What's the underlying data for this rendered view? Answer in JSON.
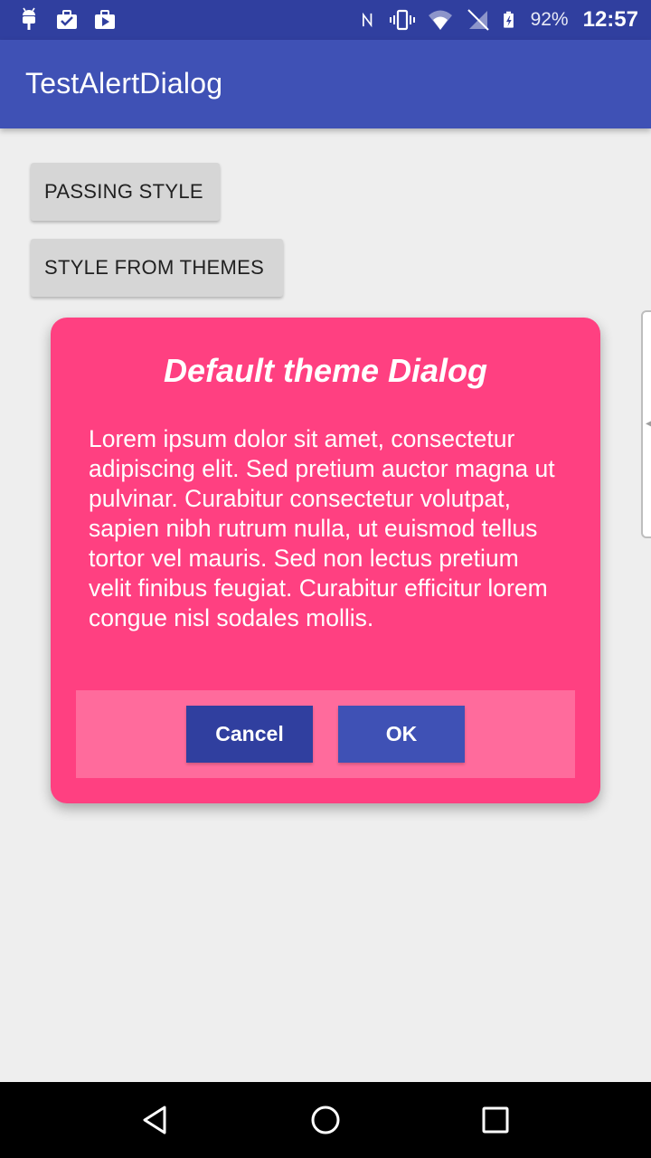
{
  "status_bar": {
    "battery_percent": "92%",
    "time": "12:57",
    "icons": [
      "android-icon",
      "briefcase-check-icon",
      "briefcase-play-icon",
      "nfc-icon",
      "vibrate-icon",
      "wifi-icon",
      "no-signal-icon",
      "battery-charging-icon"
    ]
  },
  "app_bar": {
    "title": "TestAlertDialog"
  },
  "main": {
    "buttons": [
      {
        "label": "PASSING STYLE"
      },
      {
        "label": "STYLE FROM THEMES"
      }
    ]
  },
  "dialog": {
    "title": "Default theme Dialog",
    "message": "Lorem ipsum dolor sit amet, consectetur adipiscing elit. Sed pretium auctor magna ut pulvinar. Curabitur consectetur volutpat, sapien nibh rutrum nulla, ut euismod tellus tortor vel mauris. Sed non lectus pretium velit finibus feugiat. Curabitur efficitur lorem congue nisl sodales mollis.",
    "cancel_label": "Cancel",
    "ok_label": "OK",
    "colors": {
      "background": "#ff4081",
      "button_bar": "#ff6b9c",
      "cancel": "#303f9f",
      "ok": "#3f51b5"
    }
  },
  "nav_bar": {
    "buttons": [
      "back-icon",
      "home-icon",
      "recents-icon"
    ]
  },
  "colors": {
    "status_bar": "#303f9f",
    "app_bar": "#3f51b5",
    "background": "#eeeeee"
  }
}
